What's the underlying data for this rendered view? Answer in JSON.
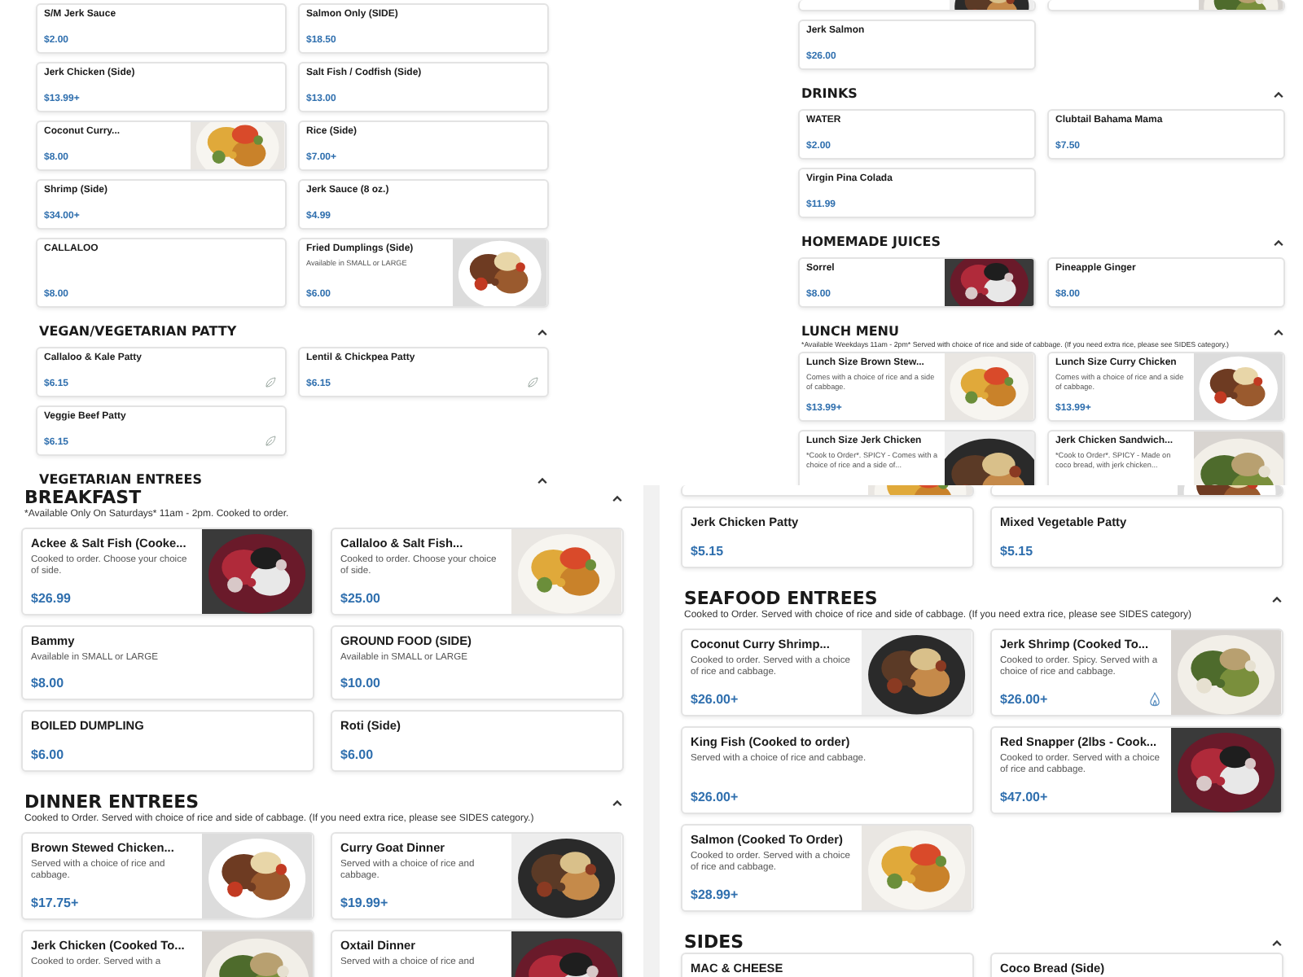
{
  "panels": [
    {
      "sections": [
        {
          "items": [
            {
              "name": "S/M Jerk Sauce",
              "price": "$2.00"
            },
            {
              "name": "Salmon Only (SIDE)",
              "price": "$18.50"
            },
            {
              "name": "Jerk Chicken (Side)",
              "price": "$13.99+"
            },
            {
              "name": "Salt Fish / Codfish (Side)",
              "price": "$13.00"
            },
            {
              "name": "Coconut Curry...",
              "price": "$8.00",
              "picture": {
                "kind": "picture"
              }
            },
            {
              "name": "Rice (Side)",
              "price": "$7.00+"
            },
            {
              "name": "Shrimp (Side)",
              "price": "$34.00+"
            },
            {
              "name": "Jerk Sauce (8 oz.)",
              "price": "$4.99"
            },
            {
              "name": "CALLALOO",
              "price": "$8.00"
            },
            {
              "name": "Fried Dumplings (Side)",
              "description": "Available in SMALL or LARGE",
              "price": "$6.00",
              "picture": {
                "kind": "picture"
              }
            }
          ]
        },
        {
          "title": "VEGAN/VEGETARIAN PATTY",
          "expanded": true,
          "items": [
            {
              "name": "Callaloo & Kale Patty",
              "price": "$6.15",
              "kind": "vegan"
            },
            {
              "name": "Lentil & Chickpea Patty",
              "price": "$6.15",
              "kind": "vegan"
            },
            {
              "name": "Veggie Beef Patty",
              "price": "$6.15",
              "kind": "vegan"
            }
          ]
        },
        {
          "title": "VEGETARIAN ENTREES",
          "expanded": true
        }
      ]
    },
    {
      "sections": [
        {
          "items": [
            {
              "picture": {
                "kind": "picture"
              }
            },
            {
              "picture": {
                "kind": "picture"
              }
            },
            {
              "name": "Jerk Salmon",
              "price": "$26.00"
            }
          ]
        },
        {
          "title": "DRINKS",
          "expanded": true,
          "items": [
            {
              "name": "WATER",
              "price": "$2.00"
            },
            {
              "name": "Clubtail Bahama Mama",
              "price": "$7.50"
            },
            {
              "name": "Virgin Pina Colada",
              "price": "$11.99"
            }
          ]
        },
        {
          "title": "HOMEMADE JUICES",
          "expanded": true,
          "items": [
            {
              "name": "Sorrel",
              "price": "$8.00",
              "picture": {
                "kind": "picture"
              }
            },
            {
              "name": "Pineapple Ginger",
              "price": "$8.00"
            }
          ]
        },
        {
          "title": "LUNCH MENU",
          "expanded": true,
          "subtitle": "*Available Weekdays 11am - 2pm* Served with choice of rice and side of cabbage. (If you need extra rice, please see SIDES category.)",
          "items": [
            {
              "name": "Lunch Size Brown Stew...",
              "description": "Comes with a choice of rice and a side of cabbage.",
              "price": "$13.99+",
              "picture": {
                "kind": "picture"
              }
            },
            {
              "name": "Lunch Size Curry Chicken",
              "description": "Comes with a choice of rice and a side of cabbage.",
              "price": "$13.99+",
              "picture": {
                "kind": "picture"
              }
            },
            {
              "name": "Lunch Size Jerk Chicken",
              "description": "*Cook to Order*. SPICY - Comes with a choice of rice and a side of...",
              "picture": {
                "kind": "picture"
              }
            },
            {
              "name": "Jerk Chicken Sandwich...",
              "description": "*Cook to Order*. SPICY - Made on coco bread, with jerk chicken...",
              "picture": {
                "kind": "picture"
              }
            }
          ]
        }
      ]
    },
    {
      "sections": [
        {
          "title": "BREAKFAST",
          "expanded": true,
          "subtitle": "*Available Only On Saturdays* 11am - 2pm. Cooked to order.",
          "items": [
            {
              "name": "Ackee & Salt Fish (Cooke...",
              "description": "Cooked to order. Choose your choice of side.",
              "price": "$26.99",
              "picture": {
                "kind": "picture"
              }
            },
            {
              "name": "Callaloo & Salt Fish...",
              "description": "Cooked to order. Choose your choice of side.",
              "price": "$25.00",
              "picture": {
                "kind": "picture"
              }
            },
            {
              "name": "Bammy",
              "description": "Available in SMALL or LARGE",
              "price": "$8.00"
            },
            {
              "name": "GROUND FOOD (SIDE)",
              "description": "Available in SMALL or LARGE",
              "price": "$10.00"
            },
            {
              "name": "BOILED DUMPLING",
              "price": "$6.00"
            },
            {
              "name": "Roti (Side)",
              "price": "$6.00"
            }
          ]
        },
        {
          "title": "DINNER ENTREES",
          "expanded": true,
          "subtitle": "Cooked to Order. Served with choice of rice and side of cabbage. (If you need extra rice, please see SIDES category.)",
          "items": [
            {
              "name": "Brown Stewed Chicken...",
              "description": "Served with a choice of rice and cabbage.",
              "price": "$17.75+",
              "picture": {
                "kind": "picture"
              }
            },
            {
              "name": "Curry Goat Dinner",
              "description": "Served with a choice of rice and cabbage.",
              "price": "$19.99+",
              "picture": {
                "kind": "picture"
              }
            },
            {
              "name": "Jerk Chicken (Cooked To...",
              "description": "Cooked to order. Served with a",
              "picture": {
                "kind": "picture"
              }
            },
            {
              "name": "Oxtail Dinner",
              "description": "Served with a choice of rice and",
              "picture": {
                "kind": "picture"
              }
            }
          ]
        }
      ]
    },
    {
      "sections": [
        {
          "items": [
            {
              "picture": {
                "kind": "picture"
              }
            },
            {
              "picture": {
                "kind": "picture"
              }
            },
            {
              "name": "Jerk Chicken Patty",
              "price": "$5.15"
            },
            {
              "name": "Mixed Vegetable Patty",
              "price": "$5.15"
            }
          ]
        },
        {
          "title": "SEAFOOD ENTREES",
          "expanded": true,
          "subtitle": "Cooked to Order. Served with choice of rice and side of cabbage. (If you need extra rice, please see SIDES category)",
          "items": [
            {
              "name": "Coconut Curry Shrimp...",
              "description": "Cooked to order. Served with a choice of rice and cabbage.",
              "price": "$26.00+",
              "picture": {
                "kind": "picture"
              }
            },
            {
              "name": "Jerk Shrimp (Cooked To...",
              "description": "Cooked to order. Spicy. Served with a choice of rice and cabbage.",
              "price": "$26.00+",
              "picture": {
                "kind": "picture"
              },
              "kind": "spicy"
            },
            {
              "name": "King Fish (Cooked to order)",
              "description": "Served with a choice of rice and cabbage.",
              "price": "$26.00+"
            },
            {
              "name": "Red Snapper (2lbs - Cook...",
              "description": "Cooked to order. Served with a choice of rice and cabbage.",
              "price": "$47.00+",
              "picture": {
                "kind": "picture"
              }
            },
            {
              "name": "Salmon (Cooked To Order)",
              "description": "Cooked to order. Served with a choice of rice and cabbage.",
              "price": "$28.99+",
              "picture": {
                "kind": "picture"
              }
            }
          ]
        },
        {
          "title": "SIDES",
          "expanded": true,
          "items": [
            {
              "name": "MAC & CHEESE"
            },
            {
              "name": "Coco Bread (Side)"
            }
          ]
        }
      ]
    }
  ]
}
